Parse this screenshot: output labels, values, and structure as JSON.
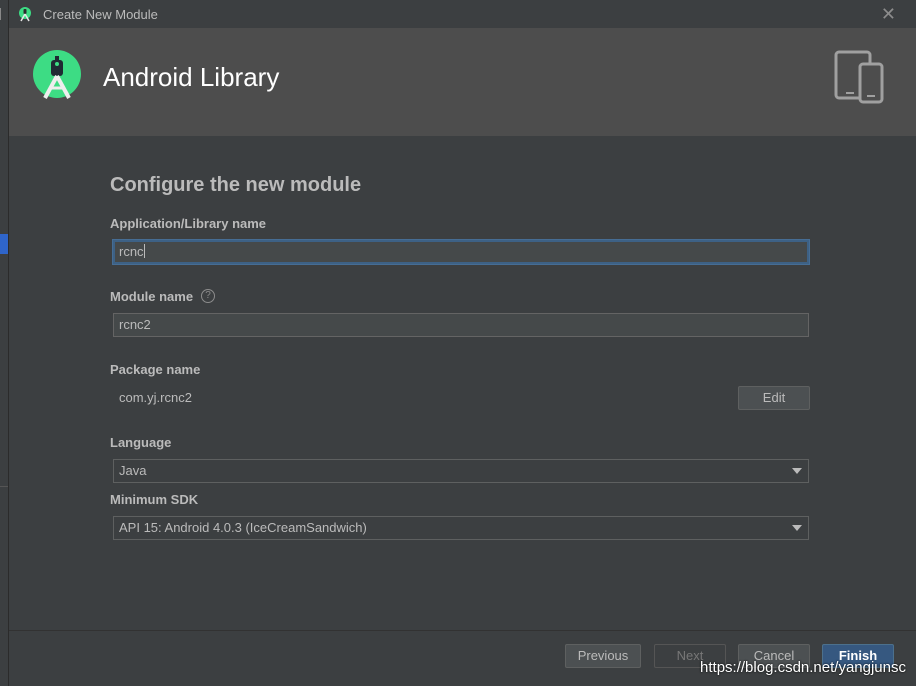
{
  "window": {
    "title": "Create New Module",
    "close_icon": "close-icon"
  },
  "header": {
    "title": "Android Library",
    "logo_icon": "android-studio-icon",
    "device_icon": "phone-tablet-icon"
  },
  "form": {
    "section_title": "Configure the new module",
    "app_name_label": "Application/Library name",
    "app_name_value": "rcnc",
    "module_name_label": "Module name",
    "module_name_value": "rcnc2",
    "help_icon": "?",
    "package_label": "Package name",
    "package_value": "com.yj.rcnc2",
    "edit_label": "Edit",
    "language_label": "Language",
    "language_value": "Java",
    "min_sdk_label": "Minimum SDK",
    "min_sdk_value": "API 15: Android 4.0.3 (IceCreamSandwich)"
  },
  "footer": {
    "previous_label": "Previous",
    "next_label": "Next",
    "cancel_label": "Cancel",
    "finish_label": "Finish"
  },
  "watermark": "https://blog.csdn.net/yangjunsc",
  "colors": {
    "background": "#3c3f41",
    "header": "#4d4d4d",
    "accent": "#365880",
    "android_green": "#3ddc84"
  }
}
